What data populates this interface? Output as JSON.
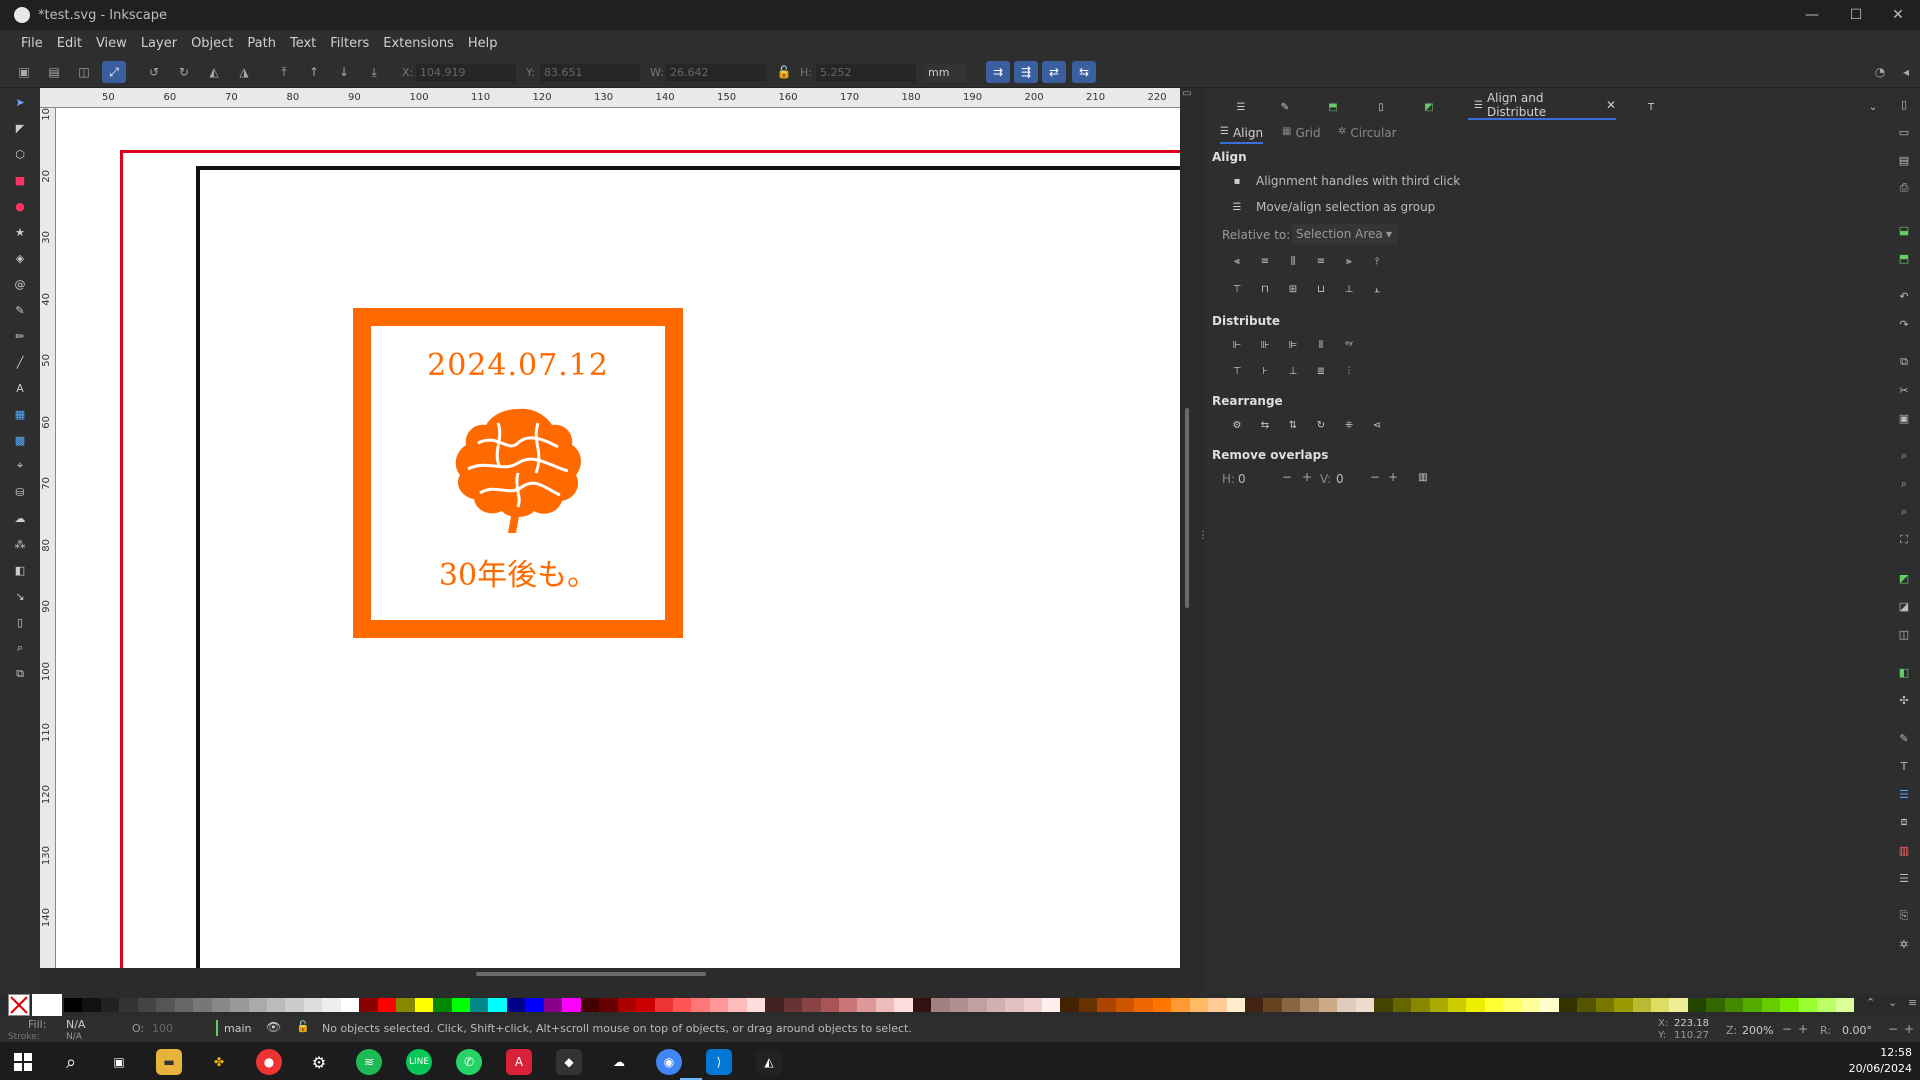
{
  "window": {
    "title": "*test.svg - Inkscape",
    "minimize": "—",
    "maximize": "☐",
    "close": "✕"
  },
  "menu": [
    "File",
    "Edit",
    "View",
    "Layer",
    "Object",
    "Path",
    "Text",
    "Filters",
    "Extensions",
    "Help"
  ],
  "toolbar": {
    "x_label": "X:",
    "x_value": "104.919",
    "y_label": "Y:",
    "y_value": "83.651",
    "w_label": "W:",
    "w_value": "26.642",
    "h_label": "H:",
    "h_value": "5.252",
    "unit": "mm"
  },
  "ruler_top": [
    "50",
    "60",
    "70",
    "80",
    "90",
    "100",
    "110",
    "120",
    "130",
    "140",
    "150",
    "160",
    "170",
    "180",
    "190",
    "200",
    "210",
    "220"
  ],
  "ruler_left": [
    "10",
    "20",
    "30",
    "40",
    "50",
    "60",
    "70",
    "80",
    "90",
    "100",
    "110",
    "120",
    "130",
    "140"
  ],
  "stamp": {
    "date": "2024.07.12",
    "caption": "30年後も。",
    "color": "#ff6a00"
  },
  "panel": {
    "tab_active": "Align and Distribute",
    "tab_close": "✕",
    "subtabs": [
      "Align",
      "Grid",
      "Circular"
    ],
    "align_heading": "Align",
    "option1": "Alignment handles with third click",
    "option2": "Move/align selection as group",
    "relative_label": "Relative to:",
    "relative_value": "Selection Area",
    "distribute_heading": "Distribute",
    "rearrange_heading": "Rearrange",
    "overlaps_heading": "Remove overlaps",
    "h_label": "H:",
    "h_value": "0",
    "v_label": "V:",
    "v_value": "0"
  },
  "status": {
    "fill_label": "Fill:",
    "fill_value": "N/A",
    "stroke_label": "Stroke:",
    "stroke_value": "N/A",
    "opacity_label": "O:",
    "opacity_value": "100",
    "layer": "main",
    "message": "No objects selected. Click, Shift+click, Alt+scroll mouse on top of objects, or drag around objects to select.",
    "x_label": "X:",
    "x_value": "223.18",
    "y_label": "Y:",
    "y_value": "110.27",
    "zoom_label": "Z:",
    "zoom_value": "200%",
    "rot_label": "R:",
    "rot_value": "0.00°"
  },
  "taskbar": {
    "time": "12:58",
    "date": "20/06/2024"
  },
  "colors": {
    "accent": "#3a5f9f",
    "stamp": "#ff6a00",
    "page_border_red": "#e0001b"
  }
}
